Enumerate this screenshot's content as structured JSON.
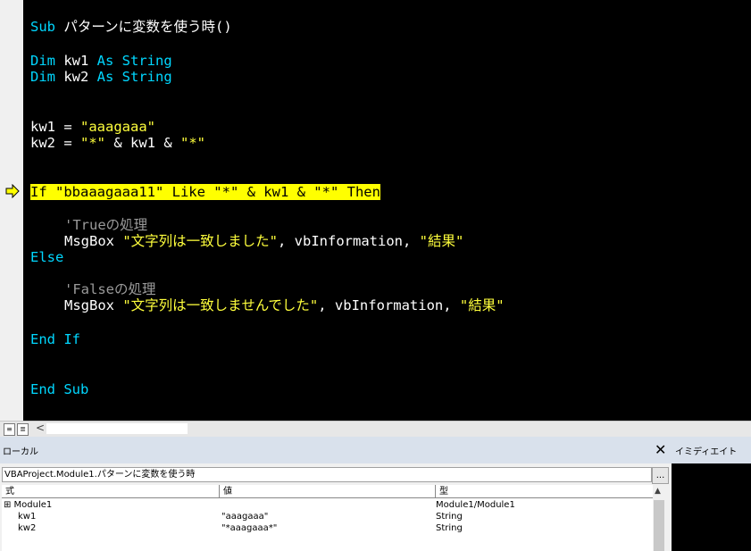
{
  "code": {
    "lines": [
      {
        "kw1": "Sub",
        "rest": " パターンに変数を使う時()"
      },
      {
        "kw1": "Dim",
        "mid": " kw1 ",
        "kw2": "As String"
      },
      {
        "kw1": "Dim",
        "mid": " kw2 ",
        "kw2": "As String"
      },
      {
        "plain": "kw1 = ",
        "str": "\"aaagaaa\""
      },
      {
        "plain": "kw2 = ",
        "str": "\"*\"",
        "after": " & kw1 & ",
        "str2": "\"*\""
      },
      {
        "highlight": "If \"bbaaagaaa11\" Like \"*\" & kw1 & \"*\" Then"
      },
      {
        "comment": "'Trueの処理"
      },
      {
        "plain": "MsgBox ",
        "str": "\"文字列は一致しました\"",
        "after": ", vbInformation, ",
        "str2": "\"結果\""
      },
      {
        "kw1": "Else"
      },
      {
        "comment": "'Falseの処理"
      },
      {
        "plain": "MsgBox ",
        "str": "\"文字列は一致しませんでした\"",
        "after": ", vbInformation, ",
        "str2": "\"結果\""
      },
      {
        "kw1": "End If"
      },
      {
        "kw1": "End Sub"
      }
    ]
  },
  "codebar": {
    "scroll_left": "<"
  },
  "locals": {
    "title": "ローカル",
    "close": "✕",
    "context": "VBAProject.Module1.パターンに変数を使う時",
    "context_btn": "...",
    "columns": {
      "expr": "式",
      "value": "値",
      "type": "型"
    },
    "rows": [
      {
        "expr": "⊞ Module1",
        "value": "",
        "type": "Module1/Module1"
      },
      {
        "expr": "kw1",
        "value": "\"aaagaaa\"",
        "type": "String"
      },
      {
        "expr": "kw2",
        "value": "\"*aaagaaa*\"",
        "type": "String"
      }
    ]
  },
  "immediate": {
    "title": "イミディエイト"
  },
  "colors": {
    "keyword": "#00d7ff",
    "string": "#ffff3c",
    "comment": "#9a9a9a",
    "highlight": "#ffff00"
  }
}
